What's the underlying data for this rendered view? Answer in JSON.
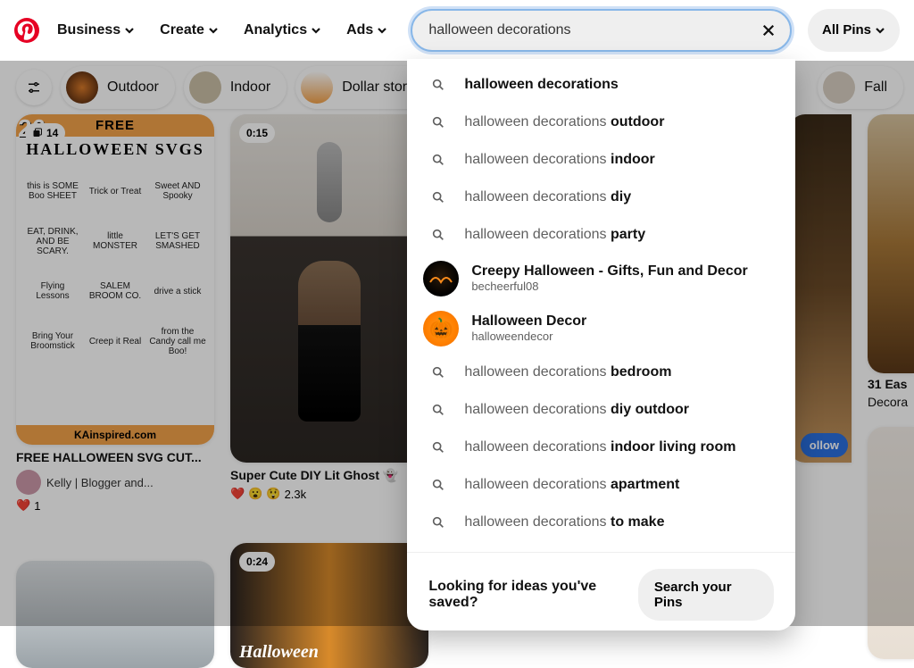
{
  "header": {
    "nav": [
      "Business",
      "Create",
      "Analytics",
      "Ads"
    ],
    "search_value": "halloween decorations ",
    "allpins_label": "All Pins"
  },
  "dropdown": {
    "suggestions_top": [
      {
        "prefix": "",
        "bold": "halloween decorations"
      },
      {
        "prefix": "halloween decorations ",
        "bold": "outdoor"
      },
      {
        "prefix": "halloween decorations ",
        "bold": "indoor"
      },
      {
        "prefix": "halloween decorations ",
        "bold": "diy"
      },
      {
        "prefix": "halloween decorations ",
        "bold": "party"
      }
    ],
    "profiles": [
      {
        "name": "Creepy Halloween - Gifts, Fun and Decor",
        "user": "becheerful08",
        "style": "creepy"
      },
      {
        "name": "Halloween Decor",
        "user": "halloweendecor",
        "style": "pumpkin"
      }
    ],
    "suggestions_bottom": [
      {
        "prefix": "halloween decorations ",
        "bold": "bedroom"
      },
      {
        "prefix": "halloween decorations ",
        "bold": "diy outdoor"
      },
      {
        "prefix": "halloween decorations ",
        "bold": "indoor living room"
      },
      {
        "prefix": "halloween decorations ",
        "bold": "apartment"
      },
      {
        "prefix": "halloween decorations ",
        "bold": "to make"
      }
    ],
    "footer_text": "Looking for ideas you've saved?",
    "footer_btn": "Search your Pins"
  },
  "filters": {
    "chips": [
      "Outdoor",
      "Indoor",
      "Dollar store",
      "Fall"
    ]
  },
  "cards": {
    "c1_badge": "14",
    "c1_banner_top": "FREE",
    "c1_banner_big": "HALLOWEEN SVGS",
    "c1_count": "26",
    "c1_cells": [
      "this is SOME Boo SHEET",
      "Trick or Treat",
      "Sweet AND Spooky",
      "EAT, DRINK, AND BE SCARY.",
      "little MONSTER",
      "LET'S GET SMASHED",
      "Flying Lessons",
      "SALEM BROOM CO.",
      "drive a stick",
      "Bring Your Broomstick",
      "Creep it Real",
      "from the Candy call me Boo!"
    ],
    "c1_foot": "KAinspired.com",
    "c1_title": "FREE HALLOWEEN SVG CUT...",
    "c1_author": "Kelly | Blogger and...",
    "c1_reaction_count": "1",
    "c2_badge": "0:15",
    "c2_title": "Super Cute DIY Lit Ghost 👻",
    "c2_reaction_count": "2.3k",
    "c3_badge": "0:24",
    "c3_title_text": "Halloween",
    "right_follow": "ollow",
    "right_title": "31 Eas",
    "right_title2": "Decora"
  }
}
